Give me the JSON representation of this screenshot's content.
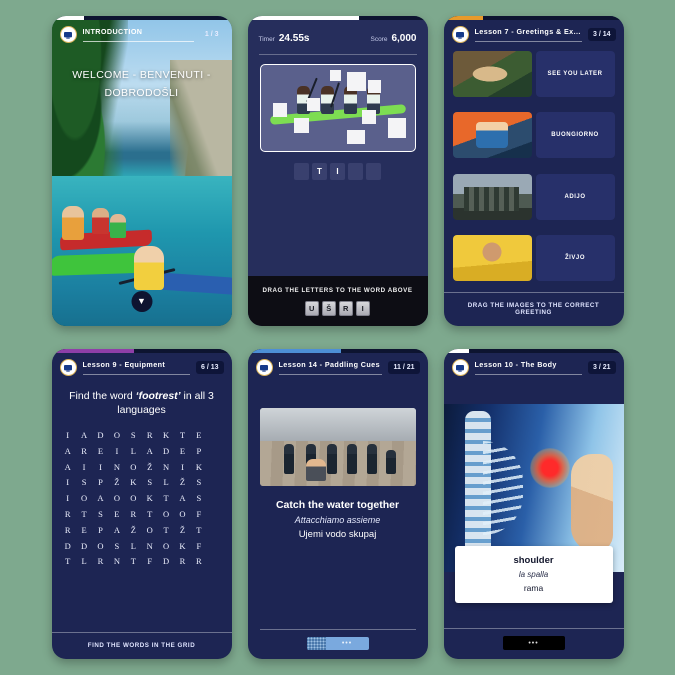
{
  "theme": {
    "page_bg": "#7ea98e",
    "card_bg": "#1d2553",
    "accent_blue": "#7aa9de",
    "accent_purple": "#8e3fa8",
    "accent_orange": "#e79a2b"
  },
  "panels": [
    {
      "id": "introduction",
      "icon": "screen-icon",
      "title": "INTRODUCTION",
      "counter": "1 / 3",
      "progress_color": "#ffffff",
      "progress_pct": 18,
      "headline": "WELCOME - BENVENUTI - DOBRODOŠLI",
      "next_icon": "chevron-down-icon"
    },
    {
      "id": "anagram-timer-game",
      "timer_label": "Timer",
      "timer_value": "24.55s",
      "score_label": "Score",
      "score_value": "6,000",
      "progress_color": "#ffffff",
      "progress_pct": 62,
      "answer_slots": [
        "",
        "T",
        "I",
        "",
        ""
      ],
      "letter_tray": [
        "U",
        "Š",
        "R",
        "I"
      ],
      "instruction": "DRAG THE LETTERS TO THE WORD ABOVE"
    },
    {
      "id": "greetings-match",
      "icon": "screen-icon",
      "title": "Lesson 7 - Greetings & Ex...",
      "counter": "3 / 14",
      "progress_color": "#e79a2b",
      "progress_pct": 22,
      "greetings": [
        "SEE YOU LATER",
        "BUONGIORNO",
        "ADIJO",
        "ŽIVJO"
      ],
      "instruction": "DRAG THE IMAGES TO THE CORRECT GREETING"
    },
    {
      "id": "word-search",
      "icon": "screen-icon",
      "title": "Lesson 9 - Equipment",
      "counter": "6 / 13",
      "progress_color": "#8e3fa8",
      "progress_pct": 46,
      "prompt_pre": "Find the word ",
      "prompt_word": "‘footrest’",
      "prompt_post": " in all 3 languages",
      "grid": [
        [
          "I",
          "A",
          "D",
          "O",
          "S",
          "R",
          "K",
          "T",
          "E",
          ""
        ],
        [
          "A",
          "R",
          "E",
          "I",
          "L",
          "A",
          "D",
          "E",
          "P",
          ""
        ],
        [
          "A",
          "I",
          "I",
          "N",
          "O",
          "Ž",
          "N",
          "I",
          "K",
          ""
        ],
        [
          "I",
          "S",
          "P",
          "Ž",
          "K",
          "S",
          "L",
          "Ž",
          "S",
          ""
        ],
        [
          "I",
          "O",
          "A",
          "O",
          "O",
          "K",
          "T",
          "A",
          "S",
          ""
        ],
        [
          "R",
          "T",
          "S",
          "E",
          "R",
          "T",
          "O",
          "O",
          "F",
          ""
        ],
        [
          "R",
          "E",
          "P",
          "A",
          "Ž",
          "O",
          "T",
          "Ž",
          "T",
          ""
        ],
        [
          "D",
          "D",
          "O",
          "S",
          "L",
          "N",
          "O",
          "K",
          "F",
          ""
        ],
        [
          "T",
          "L",
          "R",
          "N",
          "T",
          "F",
          "D",
          "R",
          "R",
          ""
        ]
      ],
      "instruction": "FIND THE WORDS IN THE GRID"
    },
    {
      "id": "paddling-cues",
      "icon": "screen-icon",
      "title": "Lesson 14 - Paddling Cues",
      "counter": "11 / 21",
      "progress_color": "#4d8fd6",
      "progress_pct": 52,
      "line_en": "Catch the water together",
      "line_it": "Attacchiamo assieme",
      "line_sl": "Ujemi vodo skupaj",
      "nav_dots": "•••"
    },
    {
      "id": "the-body",
      "icon": "screen-icon",
      "title": "Lesson 10 - The Body",
      "counter": "3 / 21",
      "progress_color": "#ffffff",
      "progress_pct": 14,
      "card_en": "shoulder",
      "card_it": "la spalla",
      "card_sl": "rama",
      "nav_dots": "•••"
    }
  ]
}
